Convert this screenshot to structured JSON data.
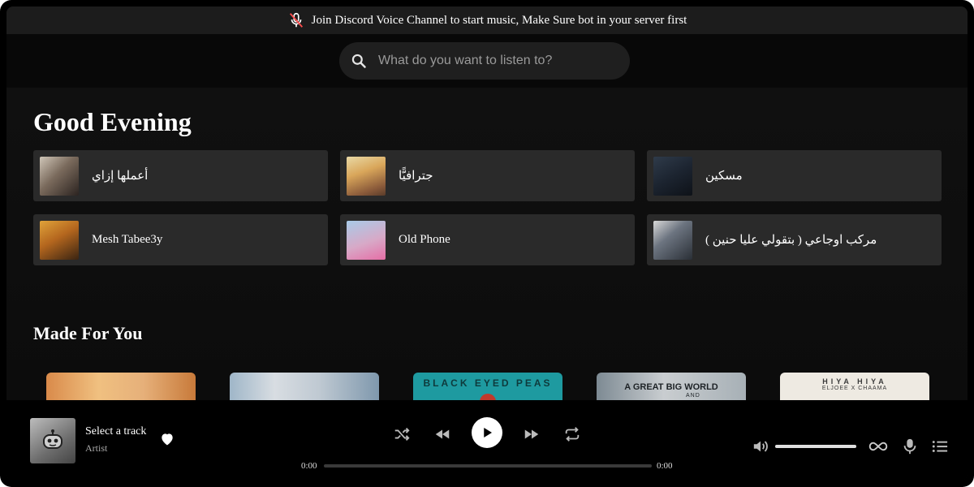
{
  "banner": {
    "text": "Join Discord Voice Channel to start music, Make Sure bot in your server first",
    "icon": "mic-off-icon"
  },
  "search": {
    "placeholder": "What do you want to listen to?",
    "value": ""
  },
  "greeting": "Good Evening",
  "quick_picks": [
    {
      "title": "أعملها إزاي"
    },
    {
      "title": "جترافيًّا"
    },
    {
      "title": "مسكين"
    },
    {
      "title": "Mesh Tabee3y"
    },
    {
      "title": "Old Phone"
    },
    {
      "title": "مركب اوجاعي ( بتقولي عليا حنين )"
    }
  ],
  "made_for_you": {
    "title": "Made For You",
    "cards": [
      {
        "text": "",
        "sub": ""
      },
      {
        "text": "",
        "sub": ""
      },
      {
        "text": "BLACK EYED PEAS",
        "sub": ""
      },
      {
        "text": "A GREAT BIG WORLD",
        "sub": "AND"
      },
      {
        "text": "HIYA HIYA",
        "sub": "ELJOEE X CHAAMA"
      }
    ]
  },
  "player": {
    "track_title": "Select a track",
    "artist": "Artist",
    "current_time": "0:00",
    "total_time": "0:00",
    "progress": 0,
    "volume": 1.0
  },
  "colors": {
    "background": "#0d0d0d",
    "card": "#2a2a2a",
    "banner": "#1c1c1c",
    "search": "#1f1f1f"
  }
}
